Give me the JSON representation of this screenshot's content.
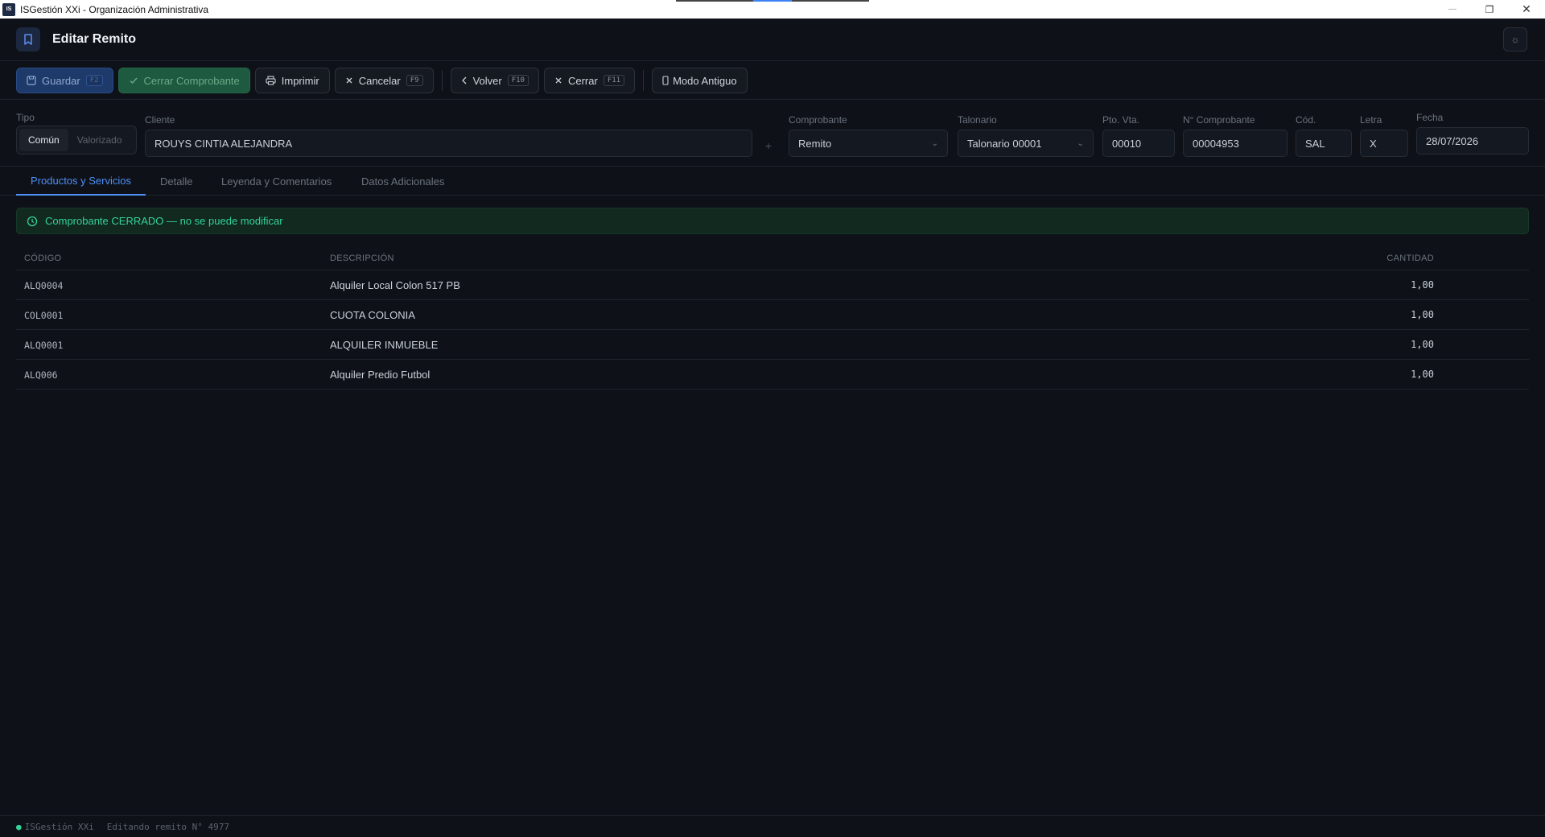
{
  "window": {
    "title": "ISGestión XXi - Organización Administrativa",
    "app_icon_text": "IS",
    "minimize_glyph": "—",
    "restore_glyph": "❐",
    "close_glyph": "✕"
  },
  "header": {
    "title": "Editar Remito",
    "icon": "bookmark-icon",
    "theme_icon": "sun-icon",
    "theme_glyph": "☼"
  },
  "toolbar": {
    "guardar": {
      "label": "Guardar",
      "key": "F2"
    },
    "cerrar_comprobante": {
      "label": "Cerrar Comprobante"
    },
    "imprimir": {
      "label": "Imprimir"
    },
    "cancelar": {
      "label": "Cancelar",
      "key": "F9"
    },
    "volver": {
      "label": "Volver",
      "key": "F10"
    },
    "cerrar": {
      "label": "Cerrar",
      "key": "F11"
    },
    "modo_antiguo": {
      "label": "Modo Antiguo"
    }
  },
  "form": {
    "tipo": {
      "label": "Tipo",
      "options": [
        "Común",
        "Valorizado"
      ],
      "selected": "Común"
    },
    "cliente": {
      "label": "Cliente",
      "value": "ROUYS CINTIA ALEJANDRA",
      "add_glyph": "+"
    },
    "comprobante": {
      "label": "Comprobante",
      "value": "Remito"
    },
    "talonario": {
      "label": "Talonario",
      "value": "Talonario 00001"
    },
    "pto_vta": {
      "label": "Pto. Vta.",
      "value": "00010"
    },
    "nro_comprobante": {
      "label": "N° Comprobante",
      "value": "00004953"
    },
    "cod": {
      "label": "Cód.",
      "value": "SAL"
    },
    "letra": {
      "label": "Letra",
      "value": "X"
    },
    "fecha": {
      "label": "Fecha",
      "value": "28/07/2026"
    }
  },
  "tabs": [
    "Productos y Servicios",
    "Detalle",
    "Leyenda y Comentarios",
    "Datos Adicionales"
  ],
  "active_tab": "Productos y Servicios",
  "banner": {
    "text": "Comprobante CERRADO — no se puede modificar"
  },
  "table": {
    "columns": [
      "CÓDIGO",
      "DESCRIPCIÓN",
      "CANTIDAD"
    ],
    "rows": [
      {
        "codigo": "ALQ0004",
        "descripcion": "Alquiler Local Colon 517 PB",
        "cantidad": "1,00"
      },
      {
        "codigo": "COL0001",
        "descripcion": "CUOTA COLONIA",
        "cantidad": "1,00"
      },
      {
        "codigo": "ALQ0001",
        "descripcion": "ALQUILER INMUEBLE",
        "cantidad": "1,00"
      },
      {
        "codigo": "ALQ006",
        "descripcion": "Alquiler Predio Futbol",
        "cantidad": "1,00"
      }
    ]
  },
  "footer": {
    "app": "ISGestión XXi",
    "status": "Editando remito N° 4977"
  },
  "colors": {
    "accent": "#4f8ff7",
    "success": "#34d399",
    "background": "#0e1117"
  }
}
